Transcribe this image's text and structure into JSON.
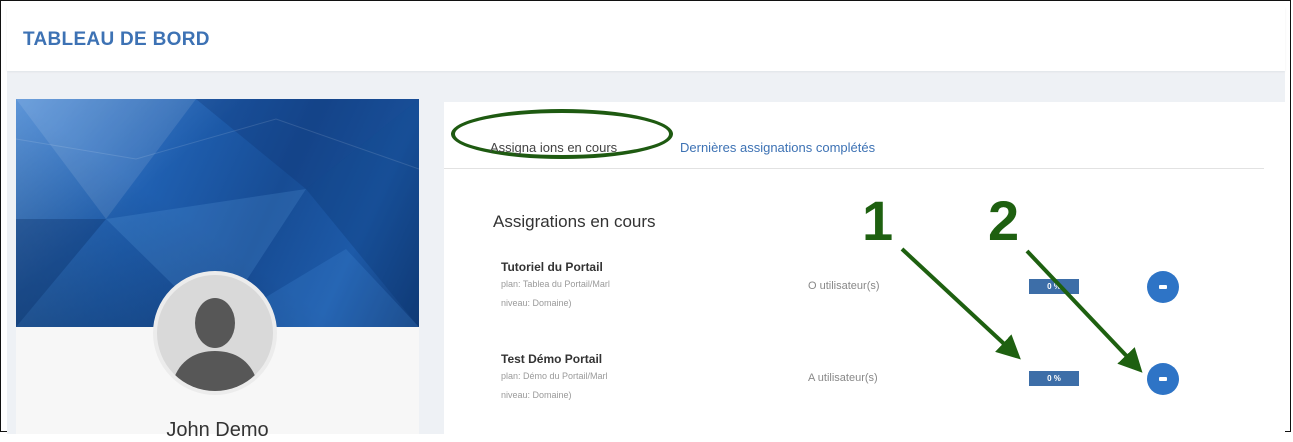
{
  "header": {
    "title": "TABLEAU DE BORD"
  },
  "profile": {
    "name": "John Demo"
  },
  "tabs": {
    "active_label": "Assigna ions en cours",
    "inactive_label": "Dernières assignations complétés"
  },
  "assignments": {
    "section_title": "Assigrations en cours",
    "rows": [
      {
        "title": "Tutoriel du Portail",
        "line1": "plan: Tablea du Portail/Marl",
        "line2": "niveau: Domaine)",
        "users": "O utilisateur(s)",
        "badge": "0 %",
        "progress": 0
      },
      {
        "title": "Test Démo Portail",
        "line1": "plan: Démo du Portail/Marl",
        "line2": "niveau: Domaine)",
        "users": "A utilisateur(s)",
        "badge": "0 %",
        "progress": 0
      }
    ]
  },
  "annotations": {
    "one": "1",
    "two": "2"
  },
  "colors": {
    "accent": "#3d72b4",
    "annotation": "#1e6010",
    "button": "#2e74c6",
    "badge": "#3d6ea8"
  },
  "icons": {
    "avatar": "person-silhouette-icon",
    "row_action": "minus-icon"
  }
}
